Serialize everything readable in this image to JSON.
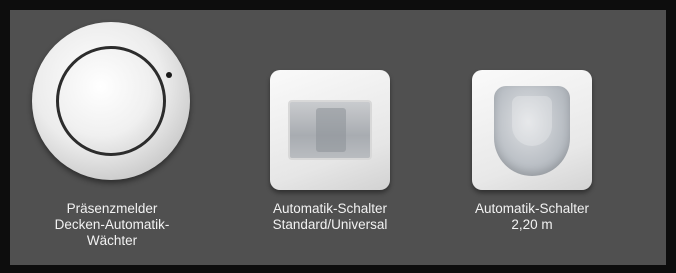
{
  "products": [
    {
      "caption": [
        "Präsenzmelder",
        "Decken-Automatik-",
        "Wächter"
      ]
    },
    {
      "caption": [
        "Automatik-Schalter",
        "Standard/Universal"
      ]
    },
    {
      "caption": [
        "Automatik-Schalter",
        "2,20 m"
      ]
    }
  ]
}
